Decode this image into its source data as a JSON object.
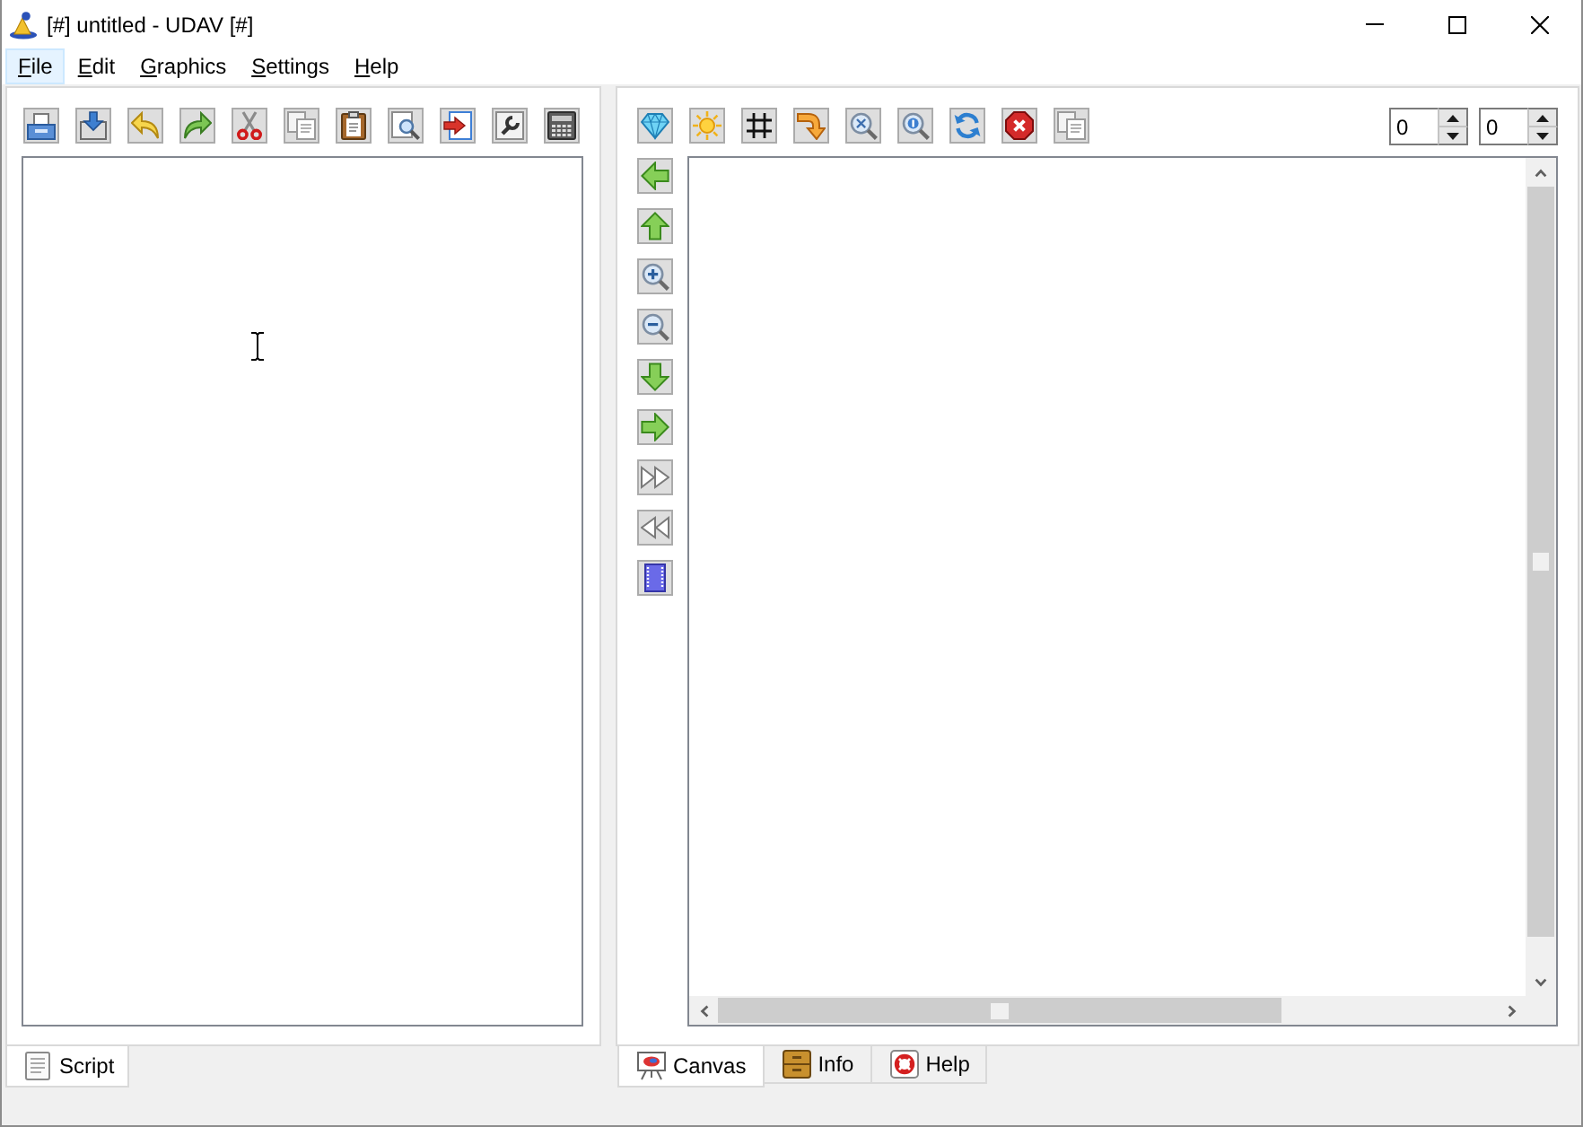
{
  "window": {
    "title": "[#] untitled - UDAV [#]"
  },
  "menu": [
    {
      "label": "File",
      "selected": true
    },
    {
      "label": "Edit",
      "selected": false
    },
    {
      "label": "Graphics",
      "selected": false
    },
    {
      "label": "Settings",
      "selected": false
    },
    {
      "label": "Help",
      "selected": false
    }
  ],
  "view_toolbar": {
    "spin_boxes": [
      {
        "value": "0"
      },
      {
        "value": "0"
      }
    ]
  },
  "script_tabs": [
    {
      "label": "Script",
      "selected": true
    }
  ],
  "view_tabs": [
    {
      "label": "Canvas",
      "selected": true
    },
    {
      "label": "Info",
      "selected": false
    },
    {
      "label": "Help",
      "selected": false
    }
  ]
}
